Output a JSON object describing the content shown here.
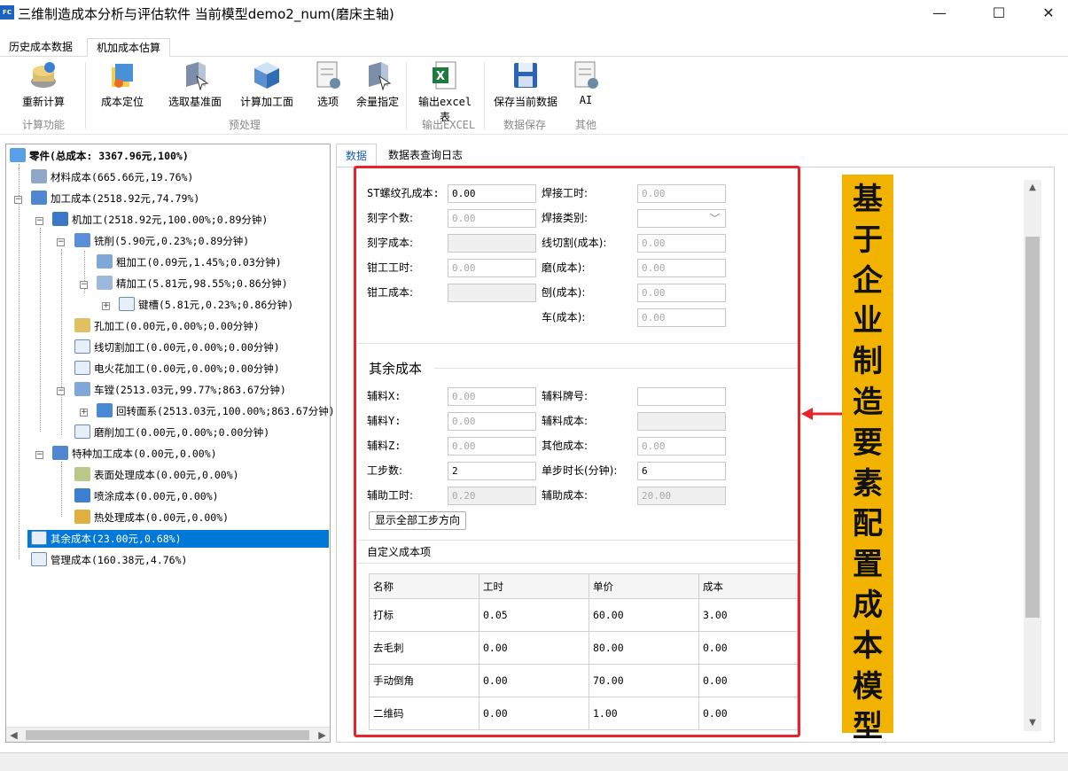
{
  "window": {
    "app_icon_text": "FC",
    "title": "三维制造成本分析与评估软件 当前模型demo2_num(磨床主轴)",
    "minimize": "—",
    "maximize": "☐",
    "close": "✕"
  },
  "ribbon_tabs": [
    {
      "label": "历史成本数据"
    },
    {
      "label": "机加成本估算"
    }
  ],
  "ribbon": {
    "buttons": {
      "recalc": "重新计算",
      "locate": "成本定位",
      "select_datum": "选取基准面",
      "calc_surface": "计算加工面",
      "options": "选项",
      "allowance": "余量指定",
      "export_excel": "输出excel表",
      "save_data": "保存当前数据",
      "ai": "AI"
    },
    "groups": {
      "calc": "计算功能",
      "preprocess": "预处理",
      "export": "输出EXCEL",
      "save": "数据保存",
      "other": "其他"
    }
  },
  "tree": {
    "root": "零件(总成本: 3367.96元,100%)",
    "material": "材料成本(665.66元,19.76%)",
    "machining_cost": "加工成本(2518.92元,74.79%)",
    "machining": "机加工(2518.92元,100.00%;0.89分钟)",
    "milling": "铣削(5.90元,0.23%;0.89分钟)",
    "rough": "粗加工(0.09元,1.45%;0.03分钟)",
    "finish": "精加工(5.81元,98.55%;0.86分钟)",
    "keyway": "键槽(5.81元,0.23%;0.86分钟)",
    "hole": "孔加工(0.00元,0.00%;0.00分钟)",
    "wire_cut": "线切割加工(0.00元,0.00%;0.00分钟)",
    "edm": "电火花加工(0.00元,0.00%;0.00分钟)",
    "turning": "车镗(2513.03元,99.77%;863.67分钟)",
    "revolve": "回转面系(2513.03元,100.00%;863.67分钟)",
    "grinding": "磨削加工(0.00元,0.00%;0.00分钟)",
    "special": "特种加工成本(0.00元,0.00%)",
    "surface": "表面处理成本(0.00元,0.00%)",
    "spray": "喷涂成本(0.00元,0.00%)",
    "heat": "热处理成本(0.00元,0.00%)",
    "other": "其余成本(23.00元,0.68%)",
    "management": "管理成本(160.38元,4.76%)"
  },
  "panel_tabs": [
    {
      "label": "数据"
    },
    {
      "label": "数据表查询日志"
    }
  ],
  "form": {
    "st_thread_cost": {
      "label": "ST螺纹孔成本:",
      "value": "0.00"
    },
    "engrave_count": {
      "label": "刻字个数:",
      "value": "0.00"
    },
    "engrave_cost": {
      "label": "刻字成本:",
      "value": ""
    },
    "bench_hours": {
      "label": "钳工工时:",
      "value": "0.00"
    },
    "bench_cost": {
      "label": "钳工成本:",
      "value": ""
    },
    "weld_hours": {
      "label": "焊接工时:",
      "value": "0.00"
    },
    "weld_type": {
      "label": "焊接类别:",
      "value": ""
    },
    "wire_cut_cost": {
      "label": "线切割(成本):",
      "value": "0.00"
    },
    "grind_cost": {
      "label": "磨(成本):",
      "value": "0.00"
    },
    "plane_cost": {
      "label": "刨(成本):",
      "value": "0.00"
    },
    "turn_cost": {
      "label": "车(成本):",
      "value": "0.00"
    }
  },
  "other_costs": {
    "title": "其余成本",
    "aux_x": {
      "label": "辅料X:",
      "value": "0.00"
    },
    "aux_y": {
      "label": "辅料Y:",
      "value": "0.00"
    },
    "aux_z": {
      "label": "辅料Z:",
      "value": "0.00"
    },
    "steps": {
      "label": "工步数:",
      "value": "2"
    },
    "aux_hours": {
      "label": "辅助工时:",
      "value": "0.20"
    },
    "aux_grade": {
      "label": "辅料牌号:",
      "value": ""
    },
    "aux_cost": {
      "label": "辅料成本:",
      "value": ""
    },
    "misc_cost": {
      "label": "其他成本:",
      "value": "0.00"
    },
    "step_duration": {
      "label": "单步时长(分钟):",
      "value": "6"
    },
    "assist_cost": {
      "label": "辅助成本:",
      "value": "20.00"
    },
    "show_dirs_button": "显示全部工步方向"
  },
  "custom_costs": {
    "title": "自定义成本项",
    "columns": [
      "名称",
      "工时",
      "单价",
      "成本"
    ],
    "rows": [
      [
        "打标",
        "0.05",
        "60.00",
        "3.00"
      ],
      [
        "去毛刺",
        "0.00",
        "80.00",
        "0.00"
      ],
      [
        "手动倒角",
        "0.00",
        "70.00",
        "0.00"
      ],
      [
        "二维码",
        "0.00",
        "1.00",
        "0.00"
      ]
    ]
  },
  "annotation": {
    "text": "基于企业制造要素配置成本模型",
    "bg_color": "#f2b300",
    "highlight_color": "#e8242a"
  }
}
